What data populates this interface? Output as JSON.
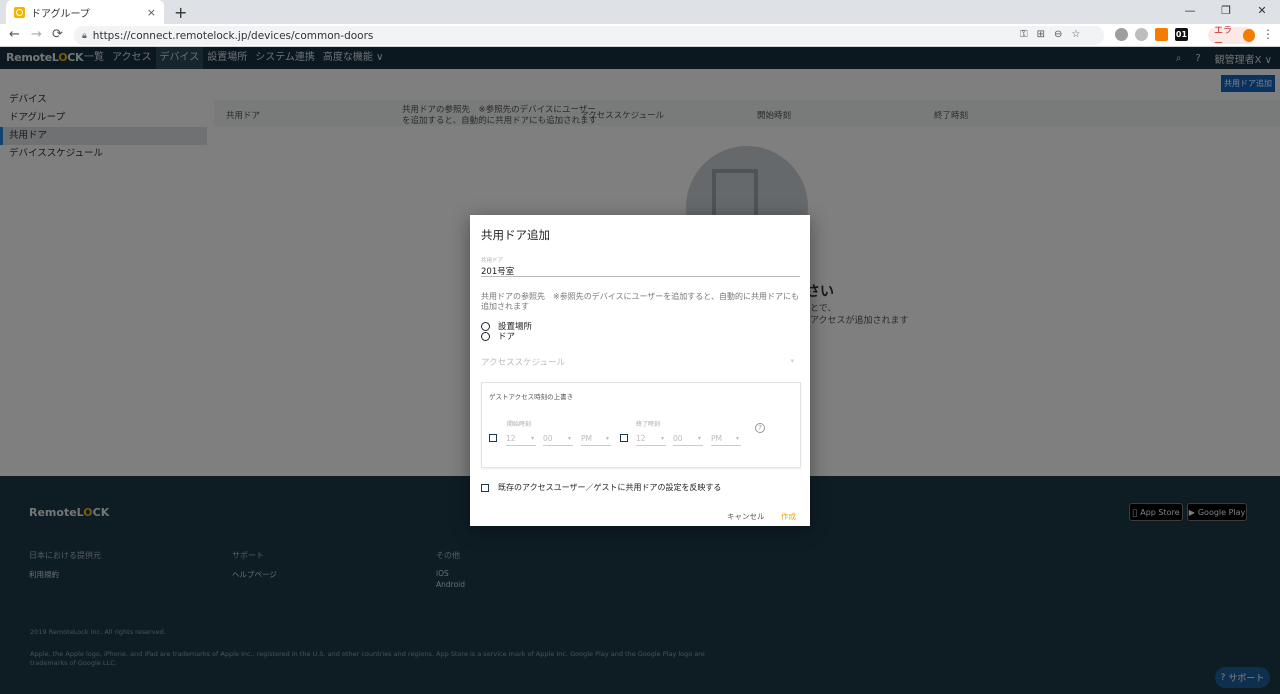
{
  "browser": {
    "tab_title": "ドアグループ",
    "tab_close": "×",
    "new_tab": "+",
    "window_controls": [
      "—",
      "❐",
      "✕"
    ],
    "back": "←",
    "forward": "→",
    "reload": "⟳",
    "url": "https://connect.remotelock.jp/devices/common-doors",
    "omni_icons": [
      "key-icon",
      "translate-icon",
      "zoom-icon",
      "star-icon"
    ],
    "omni_glyphs": [
      "⚿",
      "⊞",
      "⊖",
      "☆"
    ],
    "extensions": [
      "extension-1-icon",
      "extension-2-icon",
      "extension-3-icon",
      "extension-4-icon"
    ],
    "ext4_label": "01",
    "profile_label": "エラー",
    "menu": "⋮"
  },
  "app": {
    "logo_prefix": "Remote",
    "logo_accent": "L",
    "logo_o": "O",
    "logo_suffix": "CK",
    "nav": [
      "一覧",
      "アクセス",
      "デバイス",
      "設置場所",
      "システム連携",
      "高度な機能 ∨"
    ],
    "active_nav_index": 2,
    "search_icon": "⌕",
    "help_icon": "?",
    "user": "観管理者X ∨"
  },
  "sidebar": {
    "items": [
      "デバイス",
      "ドアグループ",
      "共用ドア",
      "デバイススケジュール"
    ],
    "active_index": 2
  },
  "main": {
    "add_button": "共用ドア追加",
    "table_headers": {
      "col1": "共用ドア",
      "col2a": "共用ドアの参照先　※参照先のデバイスにユーザー",
      "col2b": "を追加すると、自動的に共用ドアにも追加されます",
      "col3": "アクセススケジュール",
      "col4": "開始時刻",
      "col5": "終了時刻"
    },
    "empty_title": "さい",
    "empty_sub1": "とで、",
    "empty_sub2": "アクセスが追加されます"
  },
  "modal": {
    "title": "共用ドア追加",
    "field_label": "共用ドア",
    "field_value": "201号室",
    "reference_text": "共用ドアの参照先　※参照先のデバイスにユーザーを追加すると、自動的に共用ドアにも追加されます",
    "radio_options": [
      "設置場所",
      "ドア"
    ],
    "schedule_placeholder": "アクセススケジュール",
    "guest_box_title": "ゲストアクセス時刻の上書き",
    "start_label": "開始時刻",
    "end_label": "終了時刻",
    "start_hour": "12",
    "start_minute": "00",
    "start_ampm": "PM",
    "end_hour": "12",
    "end_minute": "00",
    "end_ampm": "PM",
    "help": "?",
    "reflect_label": "既存のアクセスユーザー／ゲストに共用ドアの設定を反映する",
    "cancel": "キャンセル",
    "create": "作成"
  },
  "footer": {
    "col1_header": "日本における提供元",
    "col1_link": "利用規約",
    "col2_header": "サポート",
    "col2_link": "ヘルプページ",
    "col3_header": "その他",
    "col3_link1": "iOS",
    "col3_link2": "Android",
    "app_store": "App Store",
    "google_play": "Google Play",
    "copyright": "2019 RemoteLock Inc. All rights reserved.",
    "legal1": "Apple, the Apple logo, iPhone, and iPad are trademarks of Apple Inc., registered in the U.S. and other countries and regions. App Store is a service mark of Apple Inc. Google Play and the Google Play logo are",
    "legal2": "trademarks of Google LLC.",
    "support_button": "サポート"
  },
  "colors": {
    "header_bg": "#18313f",
    "footer_bg": "#1d3a48",
    "primary": "#1565c0",
    "accent": "#f0a500"
  }
}
